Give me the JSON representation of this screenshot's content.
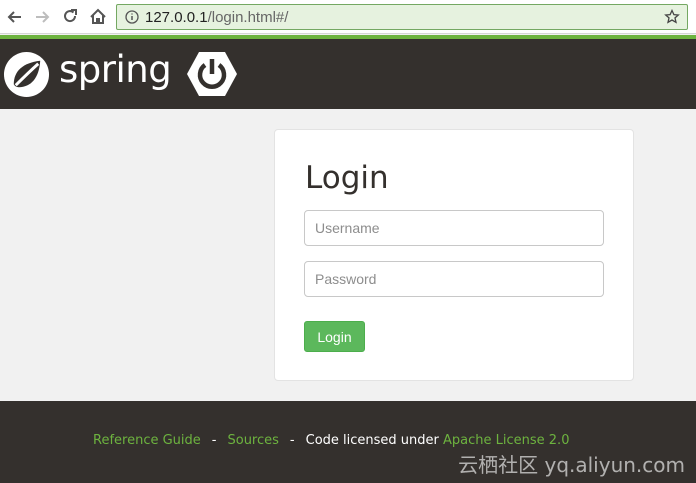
{
  "browser": {
    "url_host": "127.0.0.1",
    "url_path": "/login.html#/"
  },
  "header": {
    "brand": "spring"
  },
  "login": {
    "title": "Login",
    "username_placeholder": "Username",
    "password_placeholder": "Password",
    "button_label": "Login"
  },
  "footer": {
    "reference_guide": "Reference Guide",
    "separator": "-",
    "sources": "Sources",
    "code_licensed": "Code licensed under",
    "license": "Apache License 2.0"
  },
  "watermark": "云栖社区 yq.aliyun.com",
  "icons": {
    "back": "back-arrow-icon",
    "forward": "forward-arrow-icon",
    "reload": "reload-icon",
    "home": "home-icon",
    "info": "info-icon",
    "star": "star-icon",
    "spring_leaf": "spring-leaf-icon",
    "boot_power": "power-icon"
  },
  "colors": {
    "spring_green": "#6db33f",
    "header_dark": "#34302d",
    "button_green": "#5cb85c",
    "page_background": "#f1f1f1"
  }
}
